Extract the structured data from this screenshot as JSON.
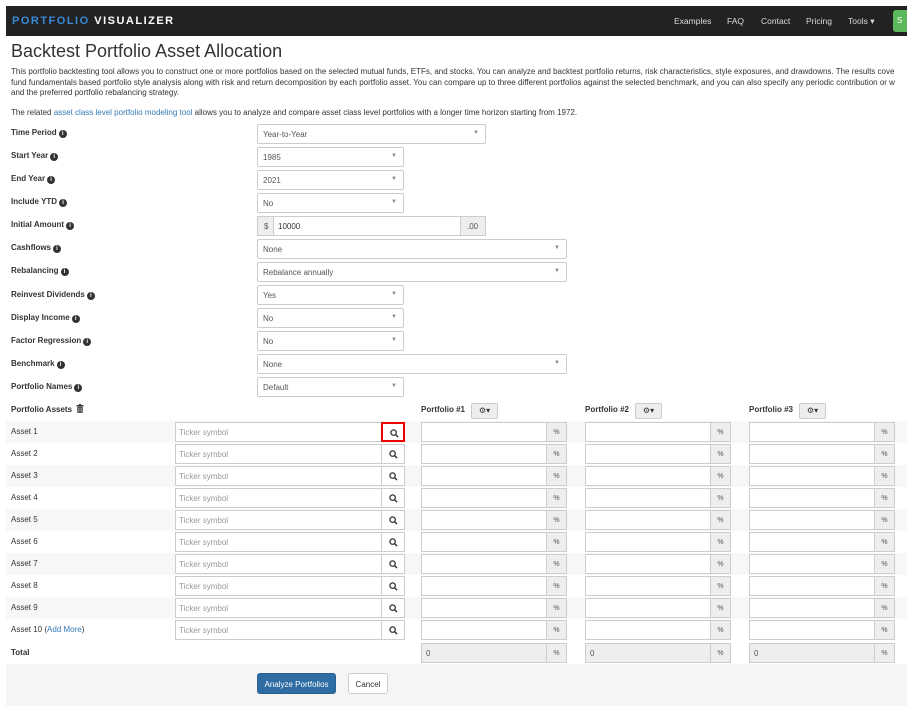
{
  "nav": {
    "brand_part1": "PORTFOLIO",
    "brand_part2": "VISUALIZER",
    "links": [
      "Examples",
      "FAQ",
      "Contact",
      "Pricing",
      "Tools ▾"
    ],
    "signup_label": "S"
  },
  "page": {
    "title": "Backtest Portfolio Asset Allocation",
    "intro_lines": [
      "This portfolio backtesting tool allows you to construct one or more portfolios based on the selected mutual funds, ETFs, and stocks. You can analyze and backtest portfolio returns, risk characteristics, style exposures, and drawdowns. The results cove",
      "fund fundamentals based portfolio style analysis along with risk and return decomposition by each portfolio asset. You can compare up to three different portfolios against the selected benchmark, and you can also specify any periodic contribution or w",
      "and the preferred portfolio rebalancing strategy."
    ],
    "related_prefix": "The related ",
    "related_link": "asset class level portfolio modeling tool",
    "related_suffix": " allows you to analyze and compare asset class level portfolios with a longer time horizon starting from 1972."
  },
  "form": {
    "time_period": {
      "label": "Time Period",
      "value": "Year-to-Year"
    },
    "start_year": {
      "label": "Start Year",
      "value": "1985"
    },
    "end_year": {
      "label": "End Year",
      "value": "2021"
    },
    "include_ytd": {
      "label": "Include YTD",
      "value": "No"
    },
    "initial_amount": {
      "label": "Initial Amount",
      "prefix": "$",
      "value": "10000",
      "suffix": ".00"
    },
    "cashflows": {
      "label": "Cashflows",
      "value": "None"
    },
    "rebalancing": {
      "label": "Rebalancing",
      "value": "Rebalance annually"
    },
    "reinvest_dividends": {
      "label": "Reinvest Dividends",
      "value": "Yes"
    },
    "display_income": {
      "label": "Display Income",
      "value": "No"
    },
    "factor_regression": {
      "label": "Factor Regression",
      "value": "No"
    },
    "benchmark": {
      "label": "Benchmark",
      "value": "None"
    },
    "portfolio_names": {
      "label": "Portfolio Names",
      "value": "Default"
    }
  },
  "assets": {
    "section_label": "Portfolio Assets",
    "portfolio_headers": [
      "Portfolio #1",
      "Portfolio #2",
      "Portfolio #3"
    ],
    "gear_label": "⚙▾",
    "ticker_placeholder": "Ticker symbol",
    "percent": "%",
    "rows": [
      "Asset 1",
      "Asset 2",
      "Asset 3",
      "Asset 4",
      "Asset 5",
      "Asset 6",
      "Asset 7",
      "Asset 8",
      "Asset 9",
      "Asset 10"
    ],
    "add_more": "Add More",
    "total_label": "Total",
    "total_values": [
      "0",
      "0",
      "0"
    ]
  },
  "actions": {
    "analyze": "Analyze Portfolios",
    "cancel": "Cancel"
  }
}
